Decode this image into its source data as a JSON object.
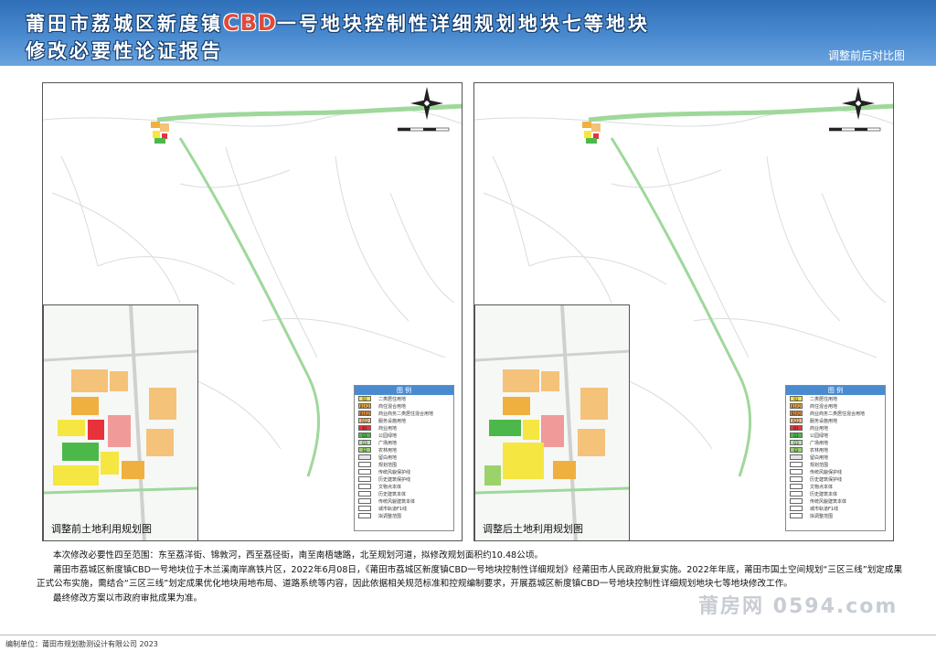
{
  "header": {
    "title_line1_a": "莆田市荔城区新度镇",
    "title_line1_cbd": "CBD",
    "title_line1_b": "一号地块控制性详细规划地块七等地块",
    "title_line2": "修改必要性论证报告",
    "compare_label": "调整前后对比图"
  },
  "panels": {
    "left_caption": "调整前土地利用规划图",
    "right_caption": "调整后土地利用规划图"
  },
  "legend": {
    "title": "图 例",
    "items": [
      {
        "code": "R2",
        "label": "二类居住用地",
        "color": "#f5e642"
      },
      {
        "code": "B1R2",
        "label": "商住混合用地",
        "color": "#f0b040"
      },
      {
        "code": "B1R2",
        "label": "商业商务二类居住混合用地",
        "color": "#e8903a"
      },
      {
        "code": "R22",
        "label": "服务设施用地",
        "color": "#f5c27a"
      },
      {
        "code": "B1",
        "label": "商业用地",
        "color": "#e8323a"
      },
      {
        "code": "G1",
        "label": "公园绿地",
        "color": "#4db84a"
      },
      {
        "code": "G3",
        "label": "广场用地",
        "color": "#b9e3b0"
      },
      {
        "code": "E2",
        "label": "农林用地",
        "color": "#9bd36a"
      },
      {
        "code": "",
        "label": "留白用地",
        "color": "#e6e6e6"
      },
      {
        "code": "",
        "label": "规划范围",
        "color": "#ffffff"
      },
      {
        "code": "",
        "label": "传统风貌保护线",
        "color": "#ffffff"
      },
      {
        "code": "",
        "label": "历史建筑保护线",
        "color": "#ffffff"
      },
      {
        "code": "",
        "label": "文物点本体",
        "color": "#ffffff"
      },
      {
        "code": "",
        "label": "历史建筑本体",
        "color": "#ffffff"
      },
      {
        "code": "",
        "label": "传统风貌建筑本体",
        "color": "#ffffff"
      },
      {
        "code": "",
        "label": "城市轨道F1线",
        "color": "#ffffff"
      },
      {
        "code": "",
        "label": "拟调整范围",
        "color": "#ffffff"
      }
    ]
  },
  "body": {
    "para1": "本次修改必要性四至范围：东至荔洋街、锦敦河，西至荔径街，南至南梧塘路，北至规划河道，拟修改规划面积约10.48公顷。",
    "para2": "莆田市荔城区新度镇CBD一号地块位于木兰溪南岸高铁片区，2022年6月08日，《莆田市荔城区新度镇CBD一号地块控制性详细规划》经莆田市人民政府批复实施。2022年年底，莆田市国土空间规划“三区三线”划定成果正式公布实施，需结合“三区三线”划定成果优化地块用地布局、道路系统等内容，因此依据相关规范标准和控规编制要求，开展荔城区新度镇CBD一号地块控制性详细规划地块七等地块修改工作。",
    "para3": "最终修改方案以市政府审批成果为准。"
  },
  "footer": {
    "editor": "编制单位：莆田市规划勘测设计有限公司 2023",
    "watermark": "莆房网 0594.com"
  },
  "colors": {
    "header_blue": "#4a8bd0",
    "road_green": "#9fd89b",
    "residential_yellow": "#f5e642",
    "commercial_orange": "#f0b040"
  }
}
